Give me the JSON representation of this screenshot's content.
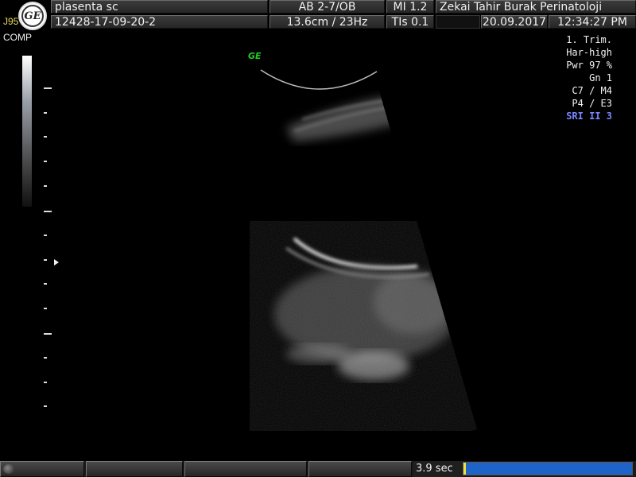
{
  "header": {
    "patient_name": "plasenta sc",
    "patient_id": "12428-17-09-20-2",
    "preset": "AB 2-7/OB",
    "depth_rate": "13.6cm / 23Hz",
    "mi": "MI  1.2",
    "tis": "TIs  0.1",
    "institution": "Zekai Tahir Burak Perinatoloji",
    "date": "20.09.2017",
    "time": "12:34:27 PM"
  },
  "left_panel": {
    "logo_text": "GE",
    "probe": "J95",
    "mode": "COMP"
  },
  "settings": {
    "lines": [
      "1. Trim.",
      "Har-high",
      "Pwr  97 %",
      "Gn   1",
      "C7 / M4",
      "P4 / E3"
    ],
    "sri": "SRI II 3"
  },
  "image": {
    "probe_mark": "GE"
  },
  "cine": {
    "time": "3.9 sec",
    "progress": 1.0
  },
  "colors": {
    "cine_fill": "#1e63c8",
    "sri": "#7a86ff",
    "probe_mark": "#22cc22",
    "probe_label": "#e8d85a"
  }
}
